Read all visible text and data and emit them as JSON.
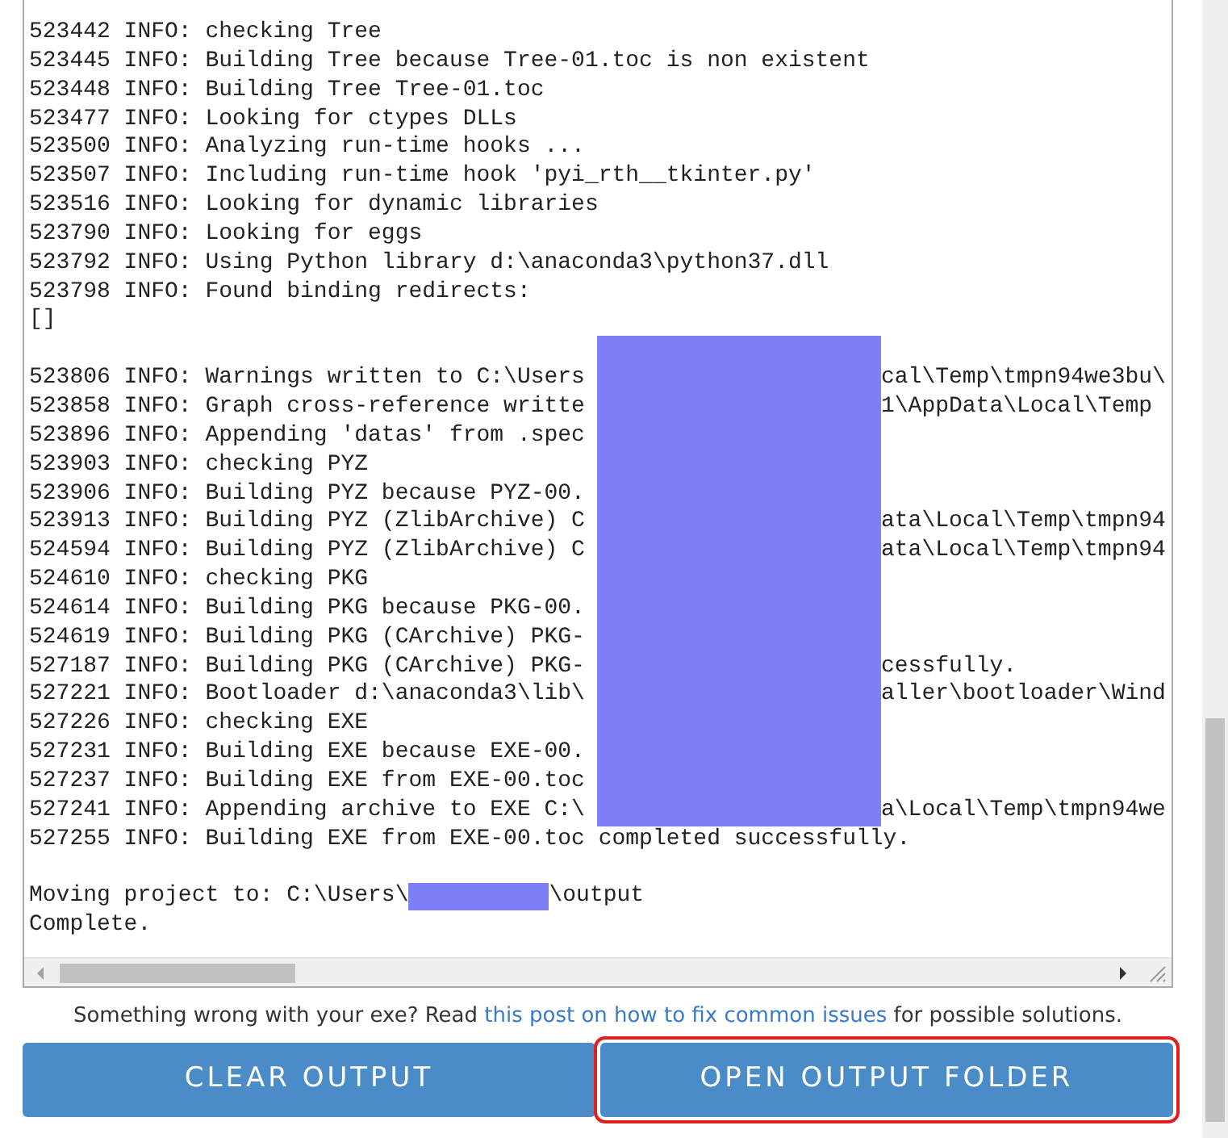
{
  "log": {
    "lines": [
      {
        "text": "523442 INFO: checking Tree",
        "masked": false
      },
      {
        "text": "523445 INFO: Building Tree because Tree-01.toc is non existent",
        "masked": false
      },
      {
        "text": "523448 INFO: Building Tree Tree-01.toc",
        "masked": false
      },
      {
        "text": "523477 INFO: Looking for ctypes DLLs",
        "masked": false
      },
      {
        "text": "523500 INFO: Analyzing run-time hooks ...",
        "masked": false
      },
      {
        "text": "523507 INFO: Including run-time hook 'pyi_rth__tkinter.py'",
        "masked": false
      },
      {
        "text": "523516 INFO: Looking for dynamic libraries",
        "masked": false
      },
      {
        "text": "523790 INFO: Looking for eggs",
        "masked": false
      },
      {
        "text": "523792 INFO: Using Python library d:\\anaconda3\\python37.dll",
        "masked": false
      },
      {
        "text": "523798 INFO: Found binding redirects:",
        "masked": false
      },
      {
        "text": "[]",
        "masked": false
      },
      {
        "masked": true
      },
      {
        "text": "523806 INFO: Warnings written to C:\\Users",
        "masked": true,
        "after": "cal\\Temp\\tmpn94we3bu\\"
      },
      {
        "text": "523858 INFO: Graph cross-reference writte",
        "masked": true,
        "after": "1\\AppData\\Local\\Temp"
      },
      {
        "text": "523896 INFO: Appending 'datas' from .spec",
        "masked": true
      },
      {
        "text": "523903 INFO: checking PYZ",
        "masked": true
      },
      {
        "text": "523906 INFO: Building PYZ because PYZ-00.",
        "masked": true
      },
      {
        "text": "523913 INFO: Building PYZ (ZlibArchive) C",
        "masked": true,
        "after": "ata\\Local\\Temp\\tmpn94"
      },
      {
        "text": "524594 INFO: Building PYZ (ZlibArchive) C",
        "masked": true,
        "after": "ata\\Local\\Temp\\tmpn94"
      },
      {
        "text": "524610 INFO: checking PKG",
        "masked": true
      },
      {
        "text": "524614 INFO: Building PKG because PKG-00.",
        "masked": true
      },
      {
        "text": "524619 INFO: Building PKG (CArchive) PKG-",
        "masked": true
      },
      {
        "text": "527187 INFO: Building PKG (CArchive) PKG-",
        "masked": true,
        "after": "cessfully."
      },
      {
        "text": "527221 INFO: Bootloader d:\\anaconda3\\lib\\",
        "masked": true,
        "after": "aller\\bootloader\\Wind"
      },
      {
        "text": "527226 INFO: checking EXE",
        "masked": true
      },
      {
        "text": "527231 INFO: Building EXE because EXE-00.",
        "masked": true
      },
      {
        "text": "527237 INFO: Building EXE from EXE-00.toc",
        "masked": true
      },
      {
        "text": "527241 INFO: Appending archive to EXE C:\\",
        "masked": true,
        "after": "a\\Local\\Temp\\tmpn94we"
      },
      {
        "text": "527255 INFO: Building EXE from EXE-00.toc completed successfully.",
        "masked": false
      },
      {
        "text": "Moving project to: C:\\Users\\",
        "masked": false,
        "blank_before": true,
        "redacted_after": "\\output"
      },
      {
        "text": "Complete.",
        "masked": false
      }
    ]
  },
  "help": {
    "before": "Something wrong with your exe? Read",
    "link": "this post on how to fix common issues",
    "after": "for possible solutions."
  },
  "buttons": [
    {
      "label": "CLEAR OUTPUT",
      "highlighted": false
    },
    {
      "label": "OPEN OUTPUT FOLDER",
      "highlighted": true
    }
  ]
}
